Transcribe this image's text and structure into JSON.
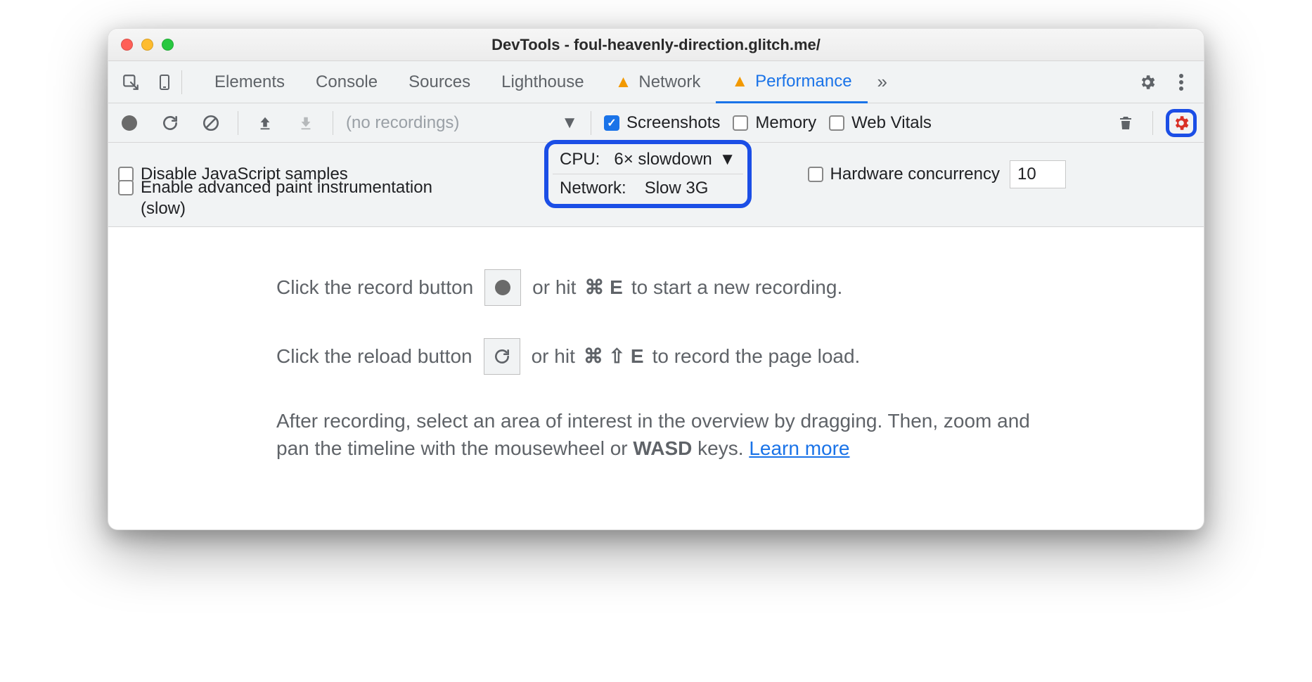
{
  "window": {
    "title": "DevTools - foul-heavenly-direction.glitch.me/"
  },
  "tabs": {
    "items": [
      "Elements",
      "Console",
      "Sources",
      "Lighthouse",
      "Network",
      "Performance"
    ],
    "active": "Performance",
    "more_glyph": "»"
  },
  "toolbar": {
    "recordings_label": "(no recordings)",
    "screenshots": "Screenshots",
    "memory": "Memory",
    "webvitals": "Web Vitals"
  },
  "settings": {
    "disable_js": "Disable JavaScript samples",
    "enable_paint": "Enable advanced paint instrumentation (slow)",
    "cpu_label": "CPU:",
    "cpu_value": "6× slowdown",
    "net_label": "Network:",
    "net_value": "Slow 3G",
    "hw_label": "Hardware concurrency",
    "hw_value": "10"
  },
  "content": {
    "l1a": "Click the record button",
    "l1b": "or hit",
    "l1k": "⌘ E",
    "l1c": "to start a new recording.",
    "l2a": "Click the reload button",
    "l2b": "or hit",
    "l2k": "⌘ ⇧ E",
    "l2c": "to record the page load.",
    "l3a": "After recording, select an area of interest in the overview by dragging. Then, zoom and pan the timeline with the mousewheel or ",
    "l3b": "WASD",
    "l3c": " keys. ",
    "learn": "Learn more"
  }
}
